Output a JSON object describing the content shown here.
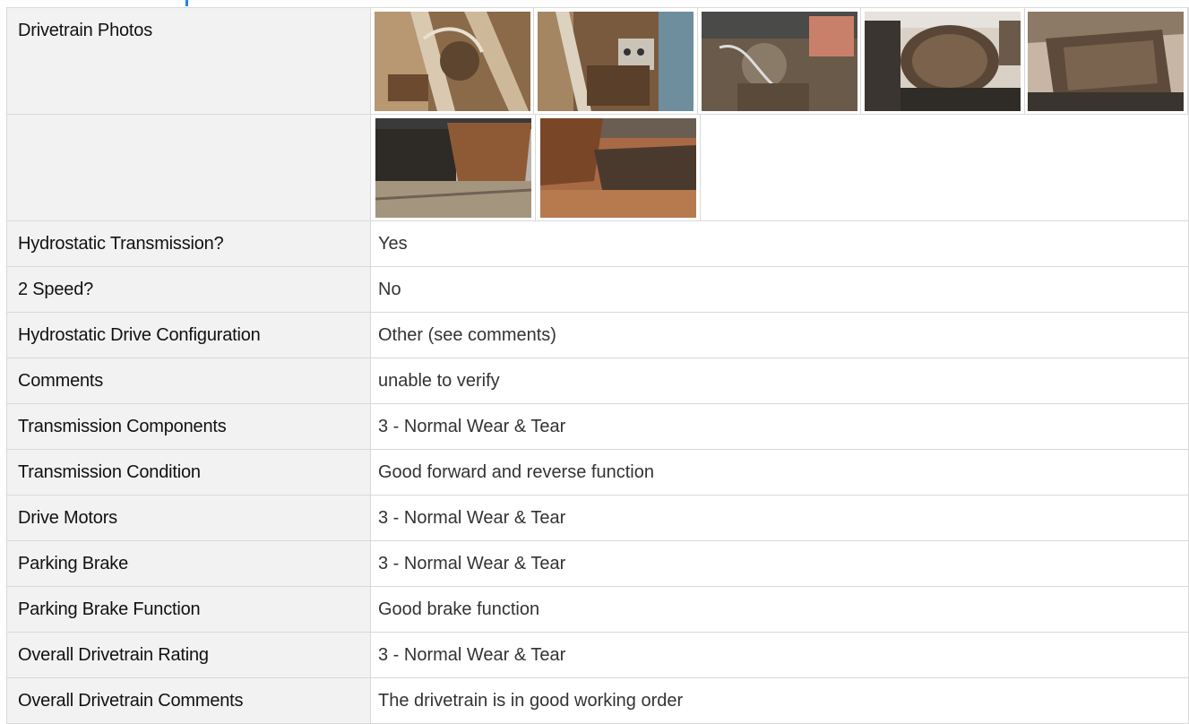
{
  "rows": [
    {
      "label": "Hydrostatic Transmission?",
      "value": "Yes"
    },
    {
      "label": "2 Speed?",
      "value": "No"
    },
    {
      "label": "Hydrostatic Drive Configuration",
      "value": "Other (see comments)"
    },
    {
      "label": "Comments",
      "value": "unable to verify"
    },
    {
      "label": "Transmission Components",
      "value": "3 - Normal Wear & Tear"
    },
    {
      "label": "Transmission Condition",
      "value": "Good forward and reverse function"
    },
    {
      "label": "Drive Motors",
      "value": "3 - Normal Wear & Tear"
    },
    {
      "label": "Parking Brake",
      "value": "3 - Normal Wear & Tear"
    },
    {
      "label": "Parking Brake Function",
      "value": "Good brake function"
    },
    {
      "label": "Overall Drivetrain Rating",
      "value": "3 - Normal Wear & Tear"
    },
    {
      "label": "Overall Drivetrain Comments",
      "value": "The drivetrain is in good working order"
    }
  ],
  "photos": {
    "label": "Drivetrain Photos",
    "row1_count": 5,
    "row2_count": 2
  },
  "colors": {
    "accent": "#1e88e5",
    "label_bg": "#f2f2f2",
    "border": "#d9d9d9"
  }
}
